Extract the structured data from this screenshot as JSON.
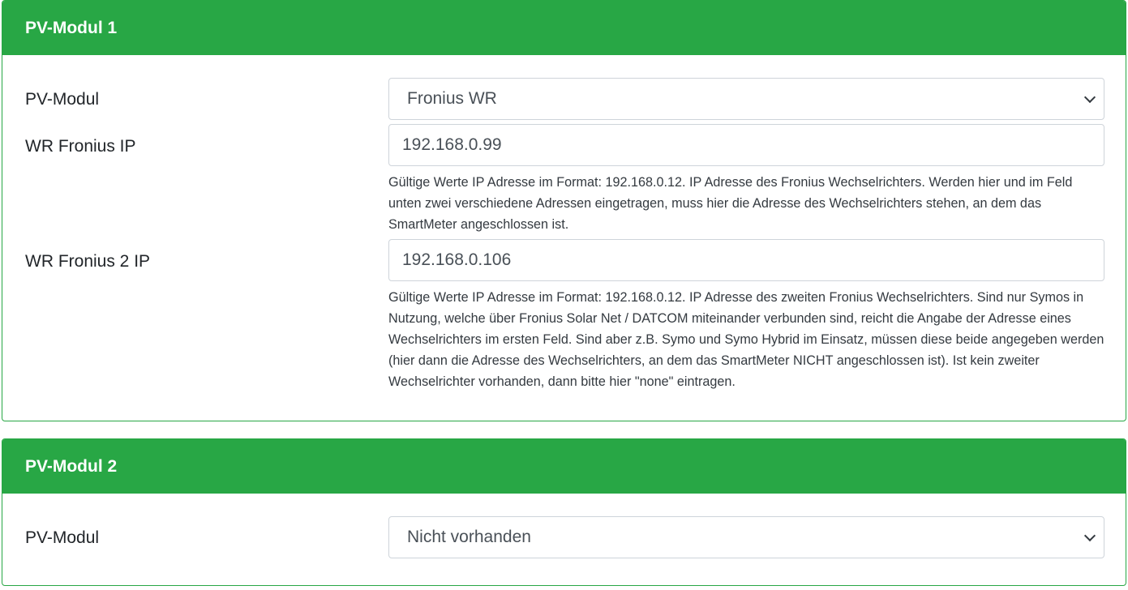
{
  "pv_modul_1": {
    "title": "PV-Modul 1",
    "module_label": "PV-Modul",
    "module_selected": "Fronius WR",
    "ip_label": "WR Fronius IP",
    "ip_value": "192.168.0.99",
    "ip_help": "Gültige Werte IP Adresse im Format: 192.168.0.12. IP Adresse des Fronius Wechselrichters. Werden hier und im Feld unten zwei verschiedene Adressen eingetragen, muss hier die Adresse des Wechselrichters stehen, an dem das SmartMeter angeschlossen ist.",
    "ip2_label": "WR Fronius 2 IP",
    "ip2_value": "192.168.0.106",
    "ip2_help": "Gültige Werte IP Adresse im Format: 192.168.0.12. IP Adresse des zweiten Fronius Wechselrichters. Sind nur Symos in Nutzung, welche über Fronius Solar Net / DATCOM miteinander verbunden sind, reicht die Angabe der Adresse eines Wechselrichters im ersten Feld. Sind aber z.B. Symo und Symo Hybrid im Einsatz, müssen diese beide angegeben werden (hier dann die Adresse des Wechselrichters, an dem das SmartMeter NICHT angeschlossen ist). Ist kein zweiter Wechselrichter vorhanden, dann bitte hier \"none\" eintragen."
  },
  "pv_modul_2": {
    "title": "PV-Modul 2",
    "module_label": "PV-Modul",
    "module_selected": "Nicht vorhanden"
  },
  "colors": {
    "header_bg": "#28a745",
    "header_text": "#ffffff",
    "border": "#ced4da"
  }
}
